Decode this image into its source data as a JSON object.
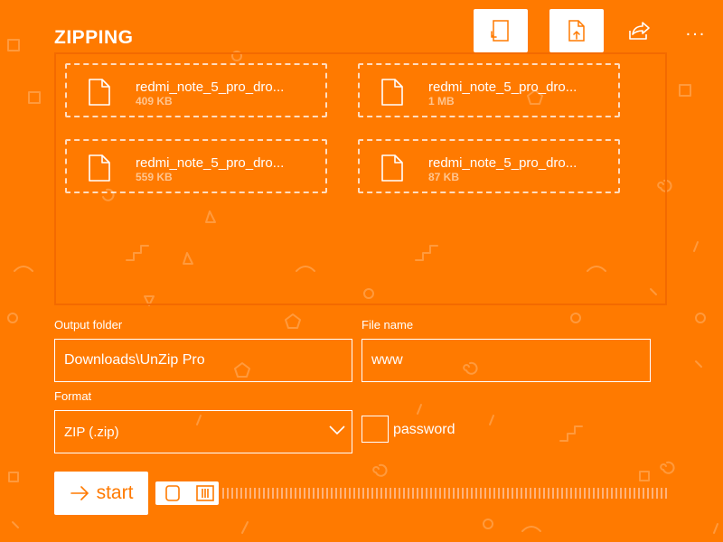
{
  "header": {
    "title": "ZIPPING",
    "buttons": [
      {
        "icon": "rotate-file-icon"
      },
      {
        "icon": "export-file-icon"
      },
      {
        "icon": "share-icon"
      },
      {
        "icon": "more-icon",
        "label": "..."
      }
    ]
  },
  "files": [
    {
      "name": "redmi_note_5_pro_dro...",
      "size": "409 KB"
    },
    {
      "name": "redmi_note_5_pro_dro...",
      "size": "1 MB"
    },
    {
      "name": "redmi_note_5_pro_dro...",
      "size": "559 KB"
    },
    {
      "name": "redmi_note_5_pro_dro...",
      "size": "87 KB"
    }
  ],
  "form": {
    "output_folder_label": "Output folder",
    "output_folder_value": "Downloads\\UnZip Pro",
    "file_name_label": "File name",
    "file_name_value": "www",
    "format_label": "Format",
    "format_value": "ZIP (.zip)",
    "password_label": "password"
  },
  "actions": {
    "start_label": "start",
    "start_icon": "arrow-right-icon"
  },
  "colors": {
    "background": "#FF7A00",
    "accent_text": "#FF7A00",
    "size_text": "#FFC58F"
  }
}
